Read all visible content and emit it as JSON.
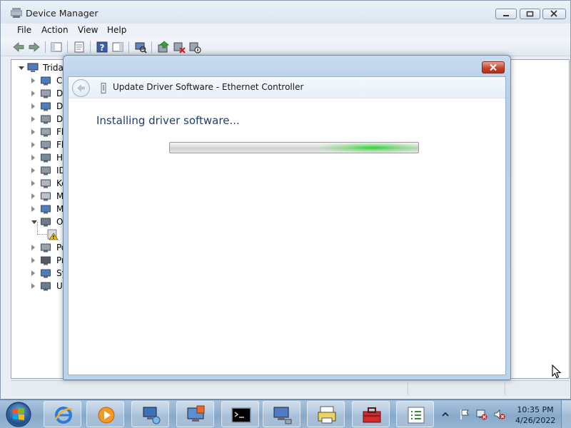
{
  "window": {
    "title": "Device Manager",
    "menu": [
      "File",
      "Action",
      "View",
      "Help"
    ],
    "tree": {
      "root_label": "Tridas",
      "items": [
        {
          "label": "Co",
          "icon": "computer-icon",
          "expanded": false
        },
        {
          "label": "Di",
          "icon": "disk-drive-icon",
          "expanded": false
        },
        {
          "label": "Di",
          "icon": "display-adapter-icon",
          "expanded": false
        },
        {
          "label": "DV",
          "icon": "dvd-drive-icon",
          "expanded": false
        },
        {
          "label": "Fl",
          "icon": "floppy-controller-icon",
          "expanded": false
        },
        {
          "label": "Fl",
          "icon": "floppy-drive-icon",
          "expanded": false
        },
        {
          "label": "Hu",
          "icon": "hid-icon",
          "expanded": false
        },
        {
          "label": "ID",
          "icon": "ide-controller-icon",
          "expanded": false
        },
        {
          "label": "Ke",
          "icon": "keyboard-icon",
          "expanded": false
        },
        {
          "label": "Mi",
          "icon": "mouse-icon",
          "expanded": false
        },
        {
          "label": "Mo",
          "icon": "monitor-icon",
          "expanded": false
        },
        {
          "label": "Ot",
          "icon": "other-devices-icon",
          "expanded": true
        },
        {
          "label": "",
          "icon": "warning-device-icon",
          "expanded": false,
          "child": true
        },
        {
          "label": "Po",
          "icon": "port-icon",
          "expanded": false
        },
        {
          "label": "Pr",
          "icon": "processor-icon",
          "expanded": false
        },
        {
          "label": "Sy",
          "icon": "system-devices-icon",
          "expanded": false
        },
        {
          "label": "Un",
          "icon": "usb-controller-icon",
          "expanded": false
        }
      ]
    }
  },
  "dialog": {
    "title": "Update Driver Software - Ethernet Controller",
    "status_text": "Installing driver software...",
    "progress_mode": "indeterminate"
  },
  "taskbar": {
    "apps": [
      "internet-explorer-icon",
      "media-player-icon",
      "network-icon",
      "remote-desktop-icon",
      "command-prompt-icon",
      "device-manager-icon",
      "printer-icon",
      "toolbox-icon",
      "task-list-icon"
    ],
    "clock": {
      "time": "10:35 PM",
      "date": "4/26/2022"
    }
  },
  "colors": {
    "accent": "#1e3f73",
    "close_red": "#c7432a",
    "progress_green": "#28d228"
  }
}
